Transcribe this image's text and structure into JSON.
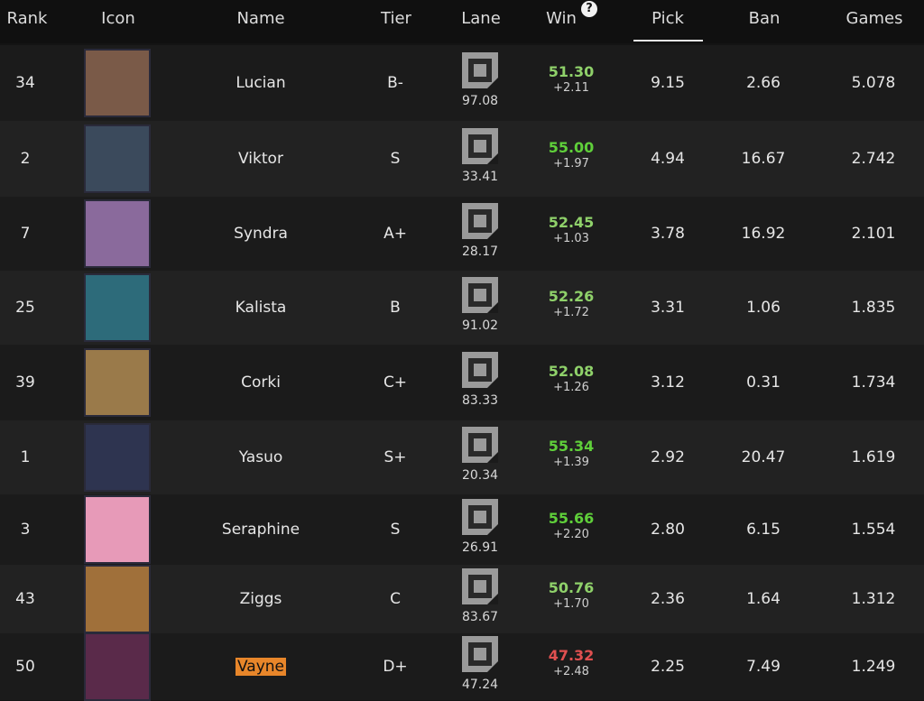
{
  "header": {
    "rank": "Rank",
    "icon": "Icon",
    "name": "Name",
    "tier": "Tier",
    "lane": "Lane",
    "win": "Win",
    "win_help": "?",
    "pick": "Pick",
    "ban": "Ban",
    "games": "Games"
  },
  "rows": [
    {
      "rank": "34",
      "name": "Lucian",
      "tier": "B-",
      "lane": "97.08",
      "win": "51.30",
      "win_delta": "+2.11",
      "pick": "9.15",
      "ban": "2.66",
      "games": "5.078",
      "win_color": "#8fd16a",
      "portrait": "#7a5a48"
    },
    {
      "rank": "2",
      "name": "Viktor",
      "tier": "S",
      "lane": "33.41",
      "win": "55.00",
      "win_delta": "+1.97",
      "pick": "4.94",
      "ban": "16.67",
      "games": "2.742",
      "win_color": "#5fcf3a",
      "portrait": "#3b4a5c"
    },
    {
      "rank": "7",
      "name": "Syndra",
      "tier": "A+",
      "lane": "28.17",
      "win": "52.45",
      "win_delta": "+1.03",
      "pick": "3.78",
      "ban": "16.92",
      "games": "2.101",
      "win_color": "#8fd16a",
      "portrait": "#8a6a9c"
    },
    {
      "rank": "25",
      "name": "Kalista",
      "tier": "B",
      "lane": "91.02",
      "win": "52.26",
      "win_delta": "+1.72",
      "pick": "3.31",
      "ban": "1.06",
      "games": "1.835",
      "win_color": "#8fd16a",
      "portrait": "#2d6b7a"
    },
    {
      "rank": "39",
      "name": "Corki",
      "tier": "C+",
      "lane": "83.33",
      "win": "52.08",
      "win_delta": "+1.26",
      "pick": "3.12",
      "ban": "0.31",
      "games": "1.734",
      "win_color": "#8fd16a",
      "portrait": "#9a7a4a"
    },
    {
      "rank": "1",
      "name": "Yasuo",
      "tier": "S+",
      "lane": "20.34",
      "win": "55.34",
      "win_delta": "+1.39",
      "pick": "2.92",
      "ban": "20.47",
      "games": "1.619",
      "win_color": "#5fcf3a",
      "portrait": "#2e3450"
    },
    {
      "rank": "3",
      "name": "Seraphine",
      "tier": "S",
      "lane": "26.91",
      "win": "55.66",
      "win_delta": "+2.20",
      "pick": "2.80",
      "ban": "6.15",
      "games": "1.554",
      "win_color": "#5fcf3a",
      "portrait": "#e79ab8"
    },
    {
      "rank": "43",
      "name": "Ziggs",
      "tier": "C",
      "lane": "83.67",
      "win": "50.76",
      "win_delta": "+1.70",
      "pick": "2.36",
      "ban": "1.64",
      "games": "1.312",
      "win_color": "#8fd16a",
      "portrait": "#a0703a"
    },
    {
      "rank": "50",
      "name": "Vayne",
      "tier": "D+",
      "lane": "47.24",
      "win": "47.32",
      "win_delta": "+2.48",
      "pick": "2.25",
      "ban": "7.49",
      "games": "1.249",
      "win_color": "#e05050",
      "portrait": "#5a2a4a"
    }
  ]
}
